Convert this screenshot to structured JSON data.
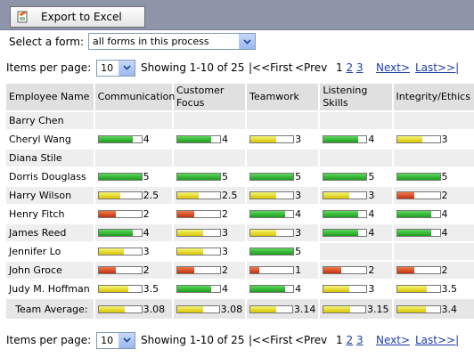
{
  "toolbar": {
    "export_label": "Export to Excel"
  },
  "form_select": {
    "label": "Select a form:",
    "value": "all forms in this process"
  },
  "pager": {
    "items_label": "Items per page:",
    "items_value": "10",
    "showing": "Showing 1-10 of 25",
    "first": "|<<First",
    "prev": "<Prev",
    "current_page": "1",
    "page2": "2",
    "page3": "3",
    "next": "Next>",
    "last": "Last>>|"
  },
  "table": {
    "columns": [
      "Employee Name",
      "Communication",
      "Customer Focus",
      "Teamwork",
      "Listening Skills",
      "Integrity/Ethics"
    ],
    "colors": {
      "green": "#1c9c1c",
      "yellow": "#d7c400",
      "red": "#c53010"
    },
    "rows": [
      {
        "name": "Barry Chen",
        "scores": [
          null,
          null,
          null,
          null,
          null
        ]
      },
      {
        "name": "Cheryl Wang",
        "scores": [
          "4",
          "4",
          "3",
          "4",
          "3"
        ]
      },
      {
        "name": "Diana Stile",
        "scores": [
          null,
          null,
          null,
          null,
          null
        ]
      },
      {
        "name": "Dorris Douglass",
        "scores": [
          "5",
          "5",
          "5",
          "5",
          "5"
        ]
      },
      {
        "name": "Harry Wilson",
        "scores": [
          "2.5",
          "2.5",
          "3",
          "3",
          "2"
        ]
      },
      {
        "name": "Henry Fitch",
        "scores": [
          "2",
          "2",
          "4",
          "4",
          "4"
        ]
      },
      {
        "name": "James Reed",
        "scores": [
          "4",
          "3",
          "3",
          "4",
          "4"
        ]
      },
      {
        "name": "Jennifer Lo",
        "scores": [
          "3",
          "3",
          "5",
          null,
          null
        ]
      },
      {
        "name": "John Groce",
        "scores": [
          "2",
          "2",
          "1",
          "2",
          "2"
        ]
      },
      {
        "name": "Judy M. Hoffman",
        "scores": [
          "3.5",
          "4",
          "4",
          "3",
          "3.5"
        ]
      }
    ],
    "team_average_label": "Team Average:",
    "team_average": [
      "3.08",
      "3.08",
      "3.14",
      "3.15",
      "3.4"
    ]
  }
}
